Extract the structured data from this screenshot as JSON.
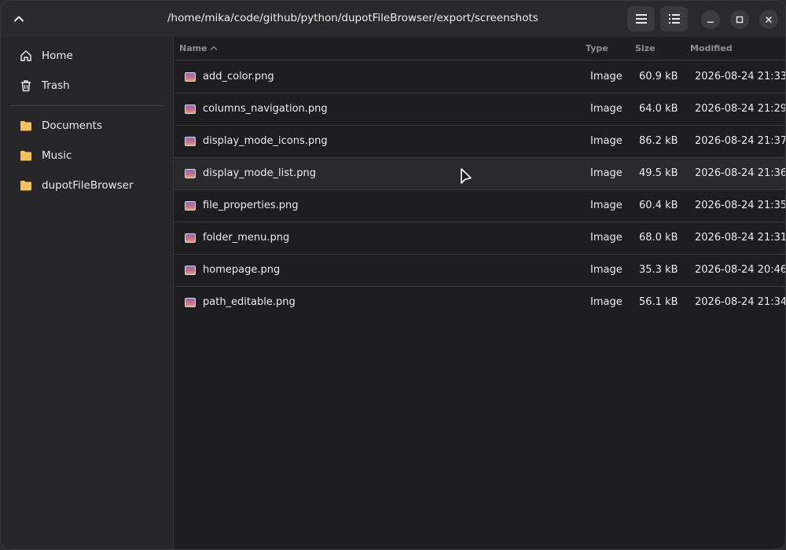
{
  "header": {
    "path": "/home/mika/code/github/python/dupotFileBrowser/export/screenshots",
    "up_icon": "chevron-up-icon",
    "view_list_icon": "hamburger-menu-icon",
    "view_detail_icon": "list-view-icon"
  },
  "sidebar": {
    "places": [
      {
        "label": "Home",
        "icon": "home-icon"
      },
      {
        "label": "Trash",
        "icon": "trash-icon"
      }
    ],
    "bookmarks": [
      {
        "label": "Documents",
        "icon": "folder-icon"
      },
      {
        "label": "Music",
        "icon": "folder-icon"
      },
      {
        "label": "dupotFileBrowser",
        "icon": "folder-icon"
      }
    ]
  },
  "columns": {
    "name": "Name",
    "type": "Type",
    "size": "Size",
    "modified": "Modified"
  },
  "files": [
    {
      "name": "add_color.png",
      "type": "Image",
      "size": "60.9 kB",
      "modified": "2026-08-24 21:33"
    },
    {
      "name": "columns_navigation.png",
      "type": "Image",
      "size": "64.0 kB",
      "modified": "2026-08-24 21:29"
    },
    {
      "name": "display_mode_icons.png",
      "type": "Image",
      "size": "86.2 kB",
      "modified": "2026-08-24 21:37"
    },
    {
      "name": "display_mode_list.png",
      "type": "Image",
      "size": "49.5 kB",
      "modified": "2026-08-24 21:36"
    },
    {
      "name": "file_properties.png",
      "type": "Image",
      "size": "60.4 kB",
      "modified": "2026-08-24 21:35"
    },
    {
      "name": "folder_menu.png",
      "type": "Image",
      "size": "68.0 kB",
      "modified": "2026-08-24 21:31"
    },
    {
      "name": "homepage.png",
      "type": "Image",
      "size": "35.3 kB",
      "modified": "2026-08-24 20:46"
    },
    {
      "name": "path_editable.png",
      "type": "Image",
      "size": "56.1 kB",
      "modified": "2026-08-24 21:34"
    }
  ],
  "colors": {
    "folder": "#f5c060",
    "background": "#1e1e20",
    "sidebar": "#27272a"
  }
}
